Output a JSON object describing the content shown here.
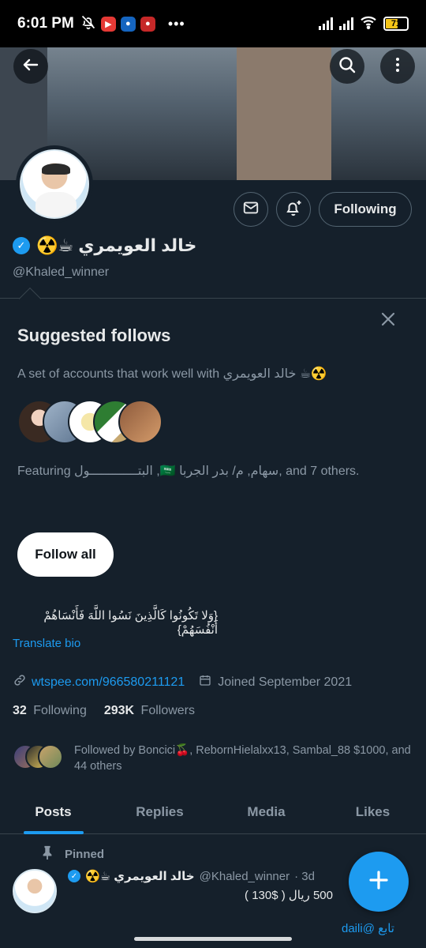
{
  "status_bar": {
    "time": "6:01 PM",
    "dots": "•••",
    "battery": "71"
  },
  "profile": {
    "display_name": "خالد العويمري ☕☢️",
    "handle": "@Khaled_winner",
    "follow_state": "Following",
    "bio": "{وَلا تَكُونُوا كَالَّذِينَ نَسُوا اللَّهَ فَأَنْسَاهُمْ أَنْفُسَهُمْ}",
    "translate_label": "Translate bio",
    "link": "wtspee.com/966580211121",
    "joined": "Joined September 2021",
    "following_count": "32",
    "following_label": "Following",
    "followers_count": "293K",
    "followers_label": "Followers",
    "followed_by": "Followed by Boncici🍒, RebornHielalxx13, Sambal_88 $1000, and 44 others"
  },
  "suggested": {
    "title": "Suggested follows",
    "description": "A set of accounts that work well with خالد العويمري ☕☢️",
    "featuring": "Featuring البتـــــــــــــول ,🇸🇦 سهام, م/ بدر الجربا, and 7 others.",
    "follow_all": "Follow all"
  },
  "tabs": [
    "Posts",
    "Replies",
    "Media",
    "Likes"
  ],
  "pinned_post": {
    "pinned_label": "Pinned",
    "author": "خالد العويمري ☕☢️",
    "handle": "@Khaled_winner",
    "time": "· 3d",
    "body": "500 ريال ( $130 )",
    "more": "تابع @daili"
  },
  "colors": {
    "background": "#15202b",
    "accent": "#1d9bf0",
    "muted": "#8b98a5",
    "text": "#e7e9ea",
    "border": "#38444d"
  },
  "icons": [
    "back-arrow-icon",
    "search-icon",
    "more-vertical-icon",
    "mail-icon",
    "bell-plus-icon",
    "close-icon",
    "link-icon",
    "calendar-icon",
    "pin-icon",
    "plus-icon"
  ]
}
